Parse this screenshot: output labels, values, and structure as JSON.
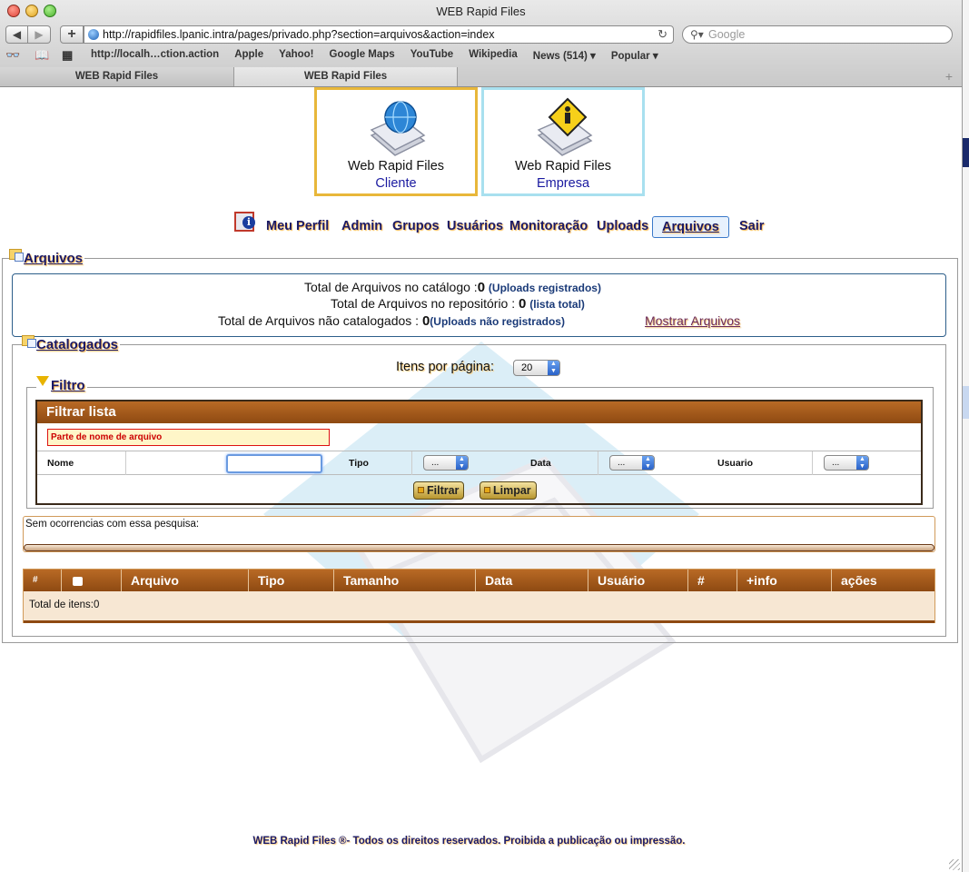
{
  "window": {
    "title": "WEB Rapid Files"
  },
  "toolbar": {
    "back_label": "◀",
    "forward_label": "▶",
    "add_label": "+",
    "url": "http://rapidfiles.lpanic.intra/pages/privado.php?section=arquivos&action=index",
    "search_placeholder": "Google",
    "reload_icon": "↻"
  },
  "bookmarks": [
    "http://localh…ction.action",
    "Apple",
    "Yahoo!",
    "Google Maps",
    "YouTube",
    "Wikipedia",
    "News (514) ▾",
    "Popular ▾"
  ],
  "tabs": [
    {
      "label": "WEB Rapid Files",
      "active": false
    },
    {
      "label": "WEB Rapid Files",
      "active": true
    }
  ],
  "logos": {
    "cliente": {
      "title": "Web Rapid Files",
      "sub": "Cliente",
      "border": "#e8b73a"
    },
    "empresa": {
      "title": "Web Rapid Files",
      "sub": "Empresa",
      "border": "#a8e0ef"
    }
  },
  "menu": {
    "items": [
      "Meu Perfil",
      "Admin",
      "Grupos",
      "Usuários",
      "Monitoração",
      "Uploads",
      "Arquivos",
      "Sair"
    ],
    "active": "Arquivos"
  },
  "arquivos": {
    "legend": "Arquivos",
    "summary": {
      "catalogo_label": "Total de Arquivos no catálogo :",
      "catalogo_value": "0",
      "catalogo_link": "(Uploads registrados)",
      "repositorio_label": "Total de Arquivos no repositório :",
      "repositorio_value": "0",
      "repositorio_link": "(lista total)",
      "nao_catalogados_label": "Total de Arquivos não catalogados :",
      "nao_catalogados_value": "0",
      "nao_catalogados_link": "(Uploads não registrados)",
      "mostrar_link": "Mostrar Arquivos"
    }
  },
  "catalogados": {
    "legend": "Catalogados",
    "itens_label": "Itens por página:",
    "itens_value": "20"
  },
  "filtro": {
    "legend": "Filtro",
    "panel_title": "Filtrar lista",
    "name_hint": "Parte de nome de arquivo",
    "labels": {
      "nome": "Nome",
      "tipo": "Tipo",
      "data": "Data",
      "usuario": "Usuario"
    },
    "select_placeholder": "...",
    "filtrar_label": "Filtrar",
    "limpar_label": "Limpar"
  },
  "results": {
    "empty_message": "Sem ocorrencias com essa pesquisa:",
    "columns": [
      "#",
      "",
      "Arquivo",
      "Tipo",
      "Tamanho",
      "Data",
      "Usuário",
      "#",
      "+info",
      "ações"
    ],
    "total_label": "Total de itens:0"
  },
  "footer": "WEB Rapid Files ®- Todos os direitos reservados. Proibida a publicação ou impressão.",
  "colors": {
    "accent_brown": "#8e4a12",
    "link_navy": "#1a1a66",
    "active_menu_border": "#3a79c9"
  }
}
